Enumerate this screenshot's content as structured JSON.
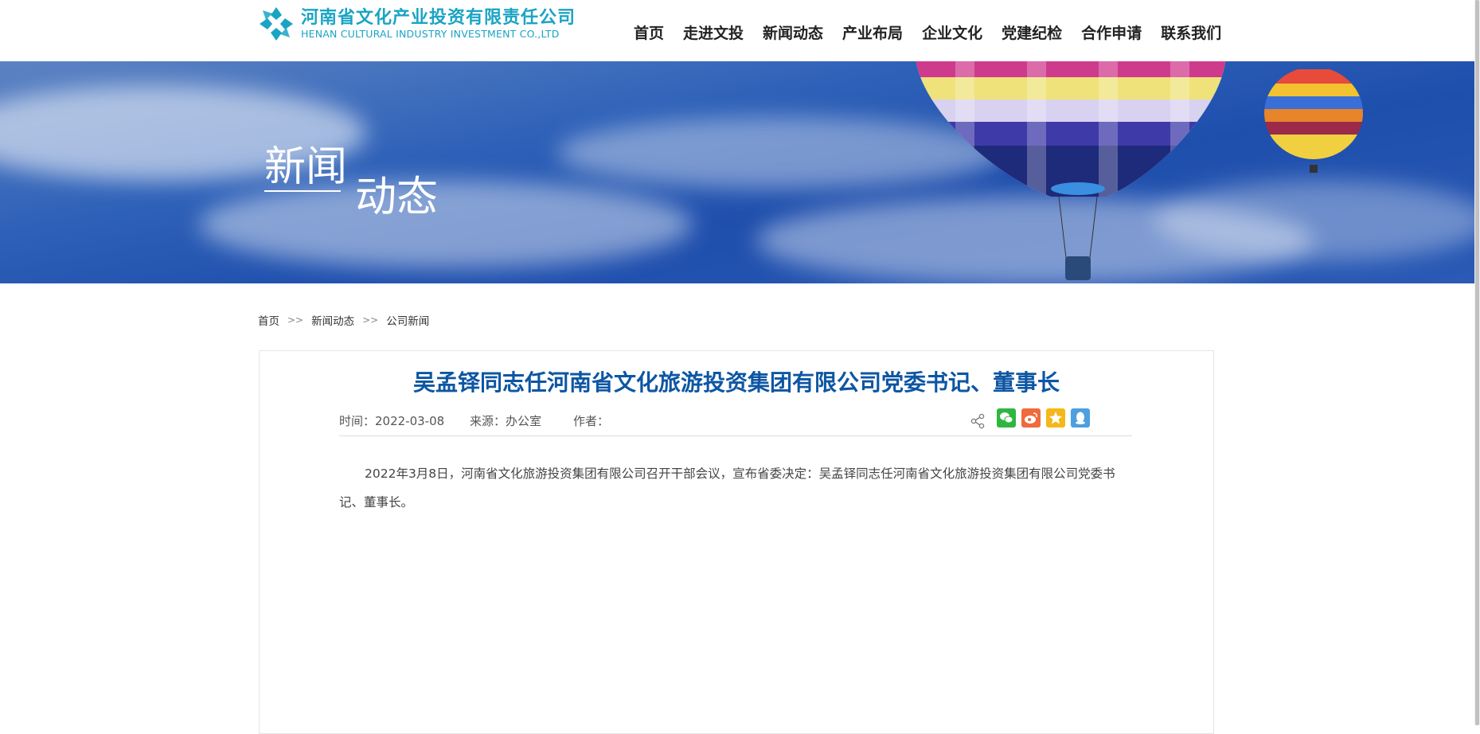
{
  "header": {
    "logo_cn": "河南省文化产业投资有限责任公司",
    "logo_en": "HENAN CULTURAL INDUSTRY INVESTMENT CO.,LTD",
    "nav": [
      "首页",
      "走进文投",
      "新闻动态",
      "产业布局",
      "企业文化",
      "党建纪检",
      "合作申请",
      "联系我们"
    ]
  },
  "banner": {
    "title_part1": "新闻",
    "title_part2": "动态"
  },
  "breadcrumb": {
    "items": [
      "首页",
      "新闻动态",
      "公司新闻"
    ],
    "separator": ">>"
  },
  "article": {
    "title": "吴孟铎同志任河南省文化旅游投资集团有限公司党委书记、董事长",
    "time": "时间：2022-03-08",
    "source": "来源：办公室",
    "author": "作者：",
    "body": "2022年3月8日，河南省文化旅游投资集团有限公司召开干部会议，宣布省委决定：吴孟铎同志任河南省文化旅游投资集团有限公司党委书记、董事长。"
  },
  "share": {
    "icons": [
      "share-icon",
      "wechat-icon",
      "weibo-icon",
      "qzone-icon",
      "qq-icon"
    ],
    "colors": {
      "wechat": "#2fb640",
      "weibo": "#f06a3c",
      "qzone": "#f5b71a",
      "qq": "#4d9fe0"
    }
  },
  "colors": {
    "brand": "#1aa4c4",
    "title": "#0d56a3"
  }
}
